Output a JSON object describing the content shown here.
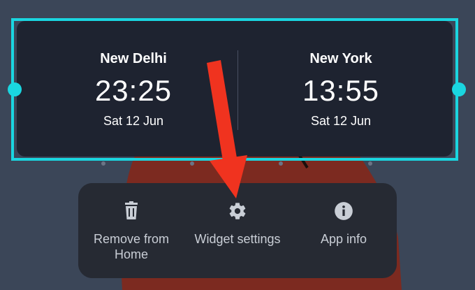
{
  "widget": {
    "clocks": [
      {
        "city": "New Delhi",
        "time": "23:25",
        "date": "Sat 12 Jun"
      },
      {
        "city": "New York",
        "time": "13:55",
        "date": "Sat 12 Jun"
      }
    ]
  },
  "menu": {
    "items": [
      {
        "label_line1": "Remove from",
        "label_line2": "Home",
        "icon": "trash-icon"
      },
      {
        "label_line1": "Widget settings",
        "label_line2": "",
        "icon": "gear-icon"
      },
      {
        "label_line1": "App info",
        "label_line2": "",
        "icon": "info-icon"
      }
    ]
  },
  "colors": {
    "selection": "#1ad6e0",
    "arrow": "#f0331f",
    "menu_bg": "#262a33",
    "widget_bg": "#1e2330"
  }
}
